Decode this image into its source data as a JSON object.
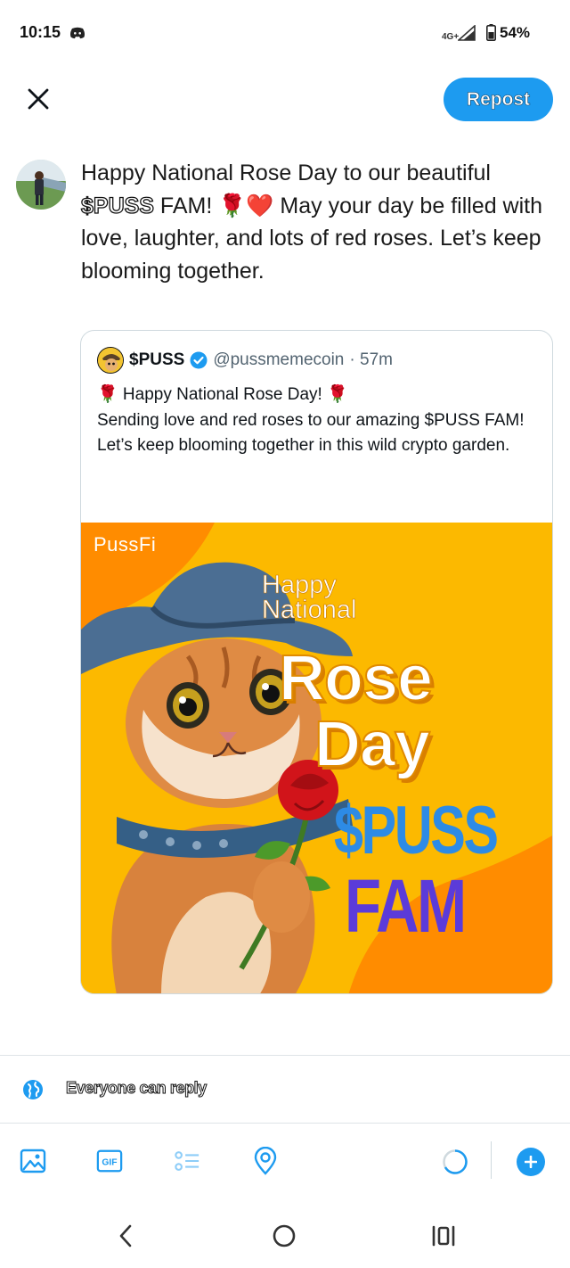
{
  "status_bar": {
    "time": "10:15",
    "network": "4G+",
    "battery": "54%",
    "icons": [
      "discord-icon",
      "signal-icon",
      "battery-icon"
    ]
  },
  "header": {
    "close_icon": "close-icon",
    "repost_label": "Repost"
  },
  "composer": {
    "text_before": "Happy National Rose Day to our beautiful ",
    "cashtag": "$PUSS",
    "text_mid": " FAM! ",
    "emoji": "🌹❤️",
    "text_after": " May your day be filled with love, laughter, and lots of red roses. Let’s keep blooming together."
  },
  "quote": {
    "name": "$PUSS",
    "handle": "@pussmemecoin",
    "time": "· 57m",
    "lines": [
      "🌹 Happy National Rose Day! 🌹",
      "Sending love and red roses to our amazing $PUSS FAM!",
      "Let’s keep blooming together in this wild crypto garden."
    ],
    "image": {
      "brand": "PussFi",
      "happy_line1": "Happy",
      "happy_line2": "National",
      "rose": "Rose",
      "day": "Day",
      "puss": "$PUSS",
      "fam": "FAM"
    }
  },
  "reply_setting": {
    "label": "Everyone can reply",
    "icon": "globe-icon"
  },
  "toolbar": {
    "icons": [
      "image-icon",
      "gif-icon",
      "poll-icon",
      "location-icon"
    ],
    "gif_label": "GIF",
    "add_icon": "plus-icon"
  },
  "colors": {
    "accent": "#1d9bf0",
    "promo_bg": "#fcb900",
    "promo_orange": "#ff8c00",
    "puss_blue": "#2d8be5",
    "fam_purple": "#5b3bd9"
  },
  "nav": [
    "back-icon",
    "home-icon",
    "recents-icon"
  ]
}
